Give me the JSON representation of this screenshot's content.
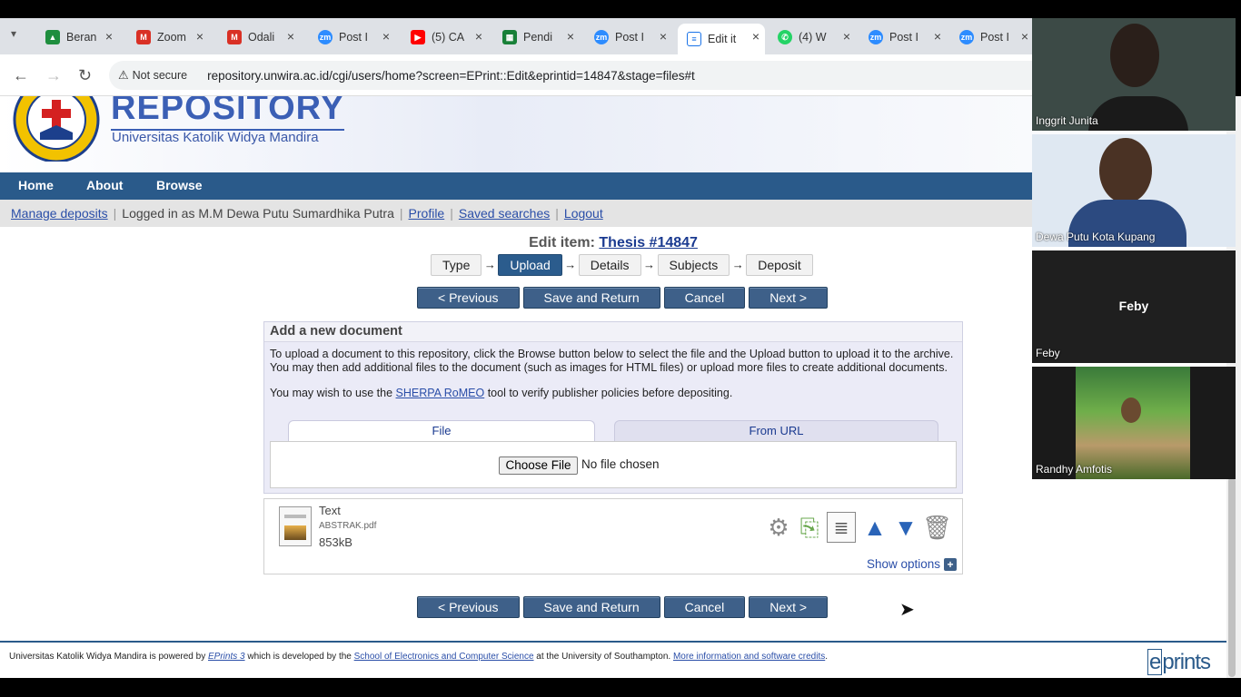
{
  "browser": {
    "tabs": [
      {
        "title": "Beran",
        "icon": "google-drive-icon",
        "color": "#1e8e3e"
      },
      {
        "title": "Zoom",
        "icon": "gmail-icon",
        "color": "#d93025"
      },
      {
        "title": "Odali",
        "icon": "gmail-icon",
        "color": "#d93025"
      },
      {
        "title": "Post I",
        "icon": "zoom-icon",
        "color": "#2d8cff"
      },
      {
        "title": "(5) CA",
        "icon": "youtube-icon",
        "color": "#ff0000"
      },
      {
        "title": "Pendi",
        "icon": "sheets-icon",
        "color": "#188038"
      },
      {
        "title": "Post I",
        "icon": "zoom-icon",
        "color": "#2d8cff"
      },
      {
        "title": "Edit it",
        "icon": "document-icon",
        "color": "#5f6368"
      },
      {
        "title": "(4) W",
        "icon": "whatsapp-icon",
        "color": "#25d366"
      },
      {
        "title": "Post I",
        "icon": "zoom-icon",
        "color": "#2d8cff"
      },
      {
        "title": "Post I",
        "icon": "zoom-icon",
        "color": "#2d8cff"
      }
    ],
    "close_glyph": "×",
    "not_secure": "Not secure",
    "url": "repository.unwira.ac.id/cgi/users/home?screen=EPrint::Edit&eprintid=14847&stage=files#t"
  },
  "site": {
    "brand": "REPOSITORY",
    "subtitle": "Universitas Katolik Widya Mandira",
    "menu": [
      "Home",
      "About",
      "Browse"
    ],
    "userbar": {
      "manage": "Manage deposits",
      "logged": "Logged in as M.M Dewa Putu Sumardhika Putra",
      "profile": "Profile",
      "saved": "Saved searches",
      "logout": "Logout"
    }
  },
  "edit": {
    "title_prefix": "Edit item:",
    "title_link": "Thesis #14847",
    "steps": [
      "Type",
      "Upload",
      "Details",
      "Subjects",
      "Deposit"
    ],
    "current_step": 1,
    "arrow": "→",
    "buttons": {
      "previous": "< Previous",
      "save": "Save and Return",
      "cancel": "Cancel",
      "next": "Next >"
    }
  },
  "add_document": {
    "heading": "Add a new document",
    "text1": "To upload a document to this repository, click the Browse button below to select the file and the Upload button to upload it to the archive. You may then add additional files to the document (such as images for HTML files) or upload more files to create additional documents.",
    "text2_before": "You may wish to use the ",
    "text2_link": "SHERPA RoMEO",
    "text2_after": " tool to verify publisher policies before depositing.",
    "tab_file": "File",
    "tab_url": "From URL",
    "choose_file": "Choose File",
    "no_file": "No file chosen"
  },
  "document": {
    "type": "Text",
    "filename": "ABSTRAK.pdf",
    "size": "853kB",
    "show_options": "Show options",
    "plus": "+"
  },
  "footer": {
    "t1": "Universitas Katolik Widya Mandira is powered by ",
    "l1": "EPrints 3",
    "t2": " which is developed by the ",
    "l2": "School of Electronics and Computer Science",
    "t3": " at the University of Southampton. ",
    "l3": "More information and software credits",
    "t4": ".",
    "logo_e": "e",
    "logo_rest": "prints"
  },
  "participants": [
    {
      "name": "Inggrit Junita",
      "bg": "#3c4a46"
    },
    {
      "name": "Dewa Putu Kota Kupang",
      "bg": "#c9d6e6"
    },
    {
      "name": "Feby",
      "bg": "#1f1f1f",
      "label_center": "Feby"
    },
    {
      "name": "Randhy Amfotis",
      "bg": "#1a1a1a"
    }
  ]
}
